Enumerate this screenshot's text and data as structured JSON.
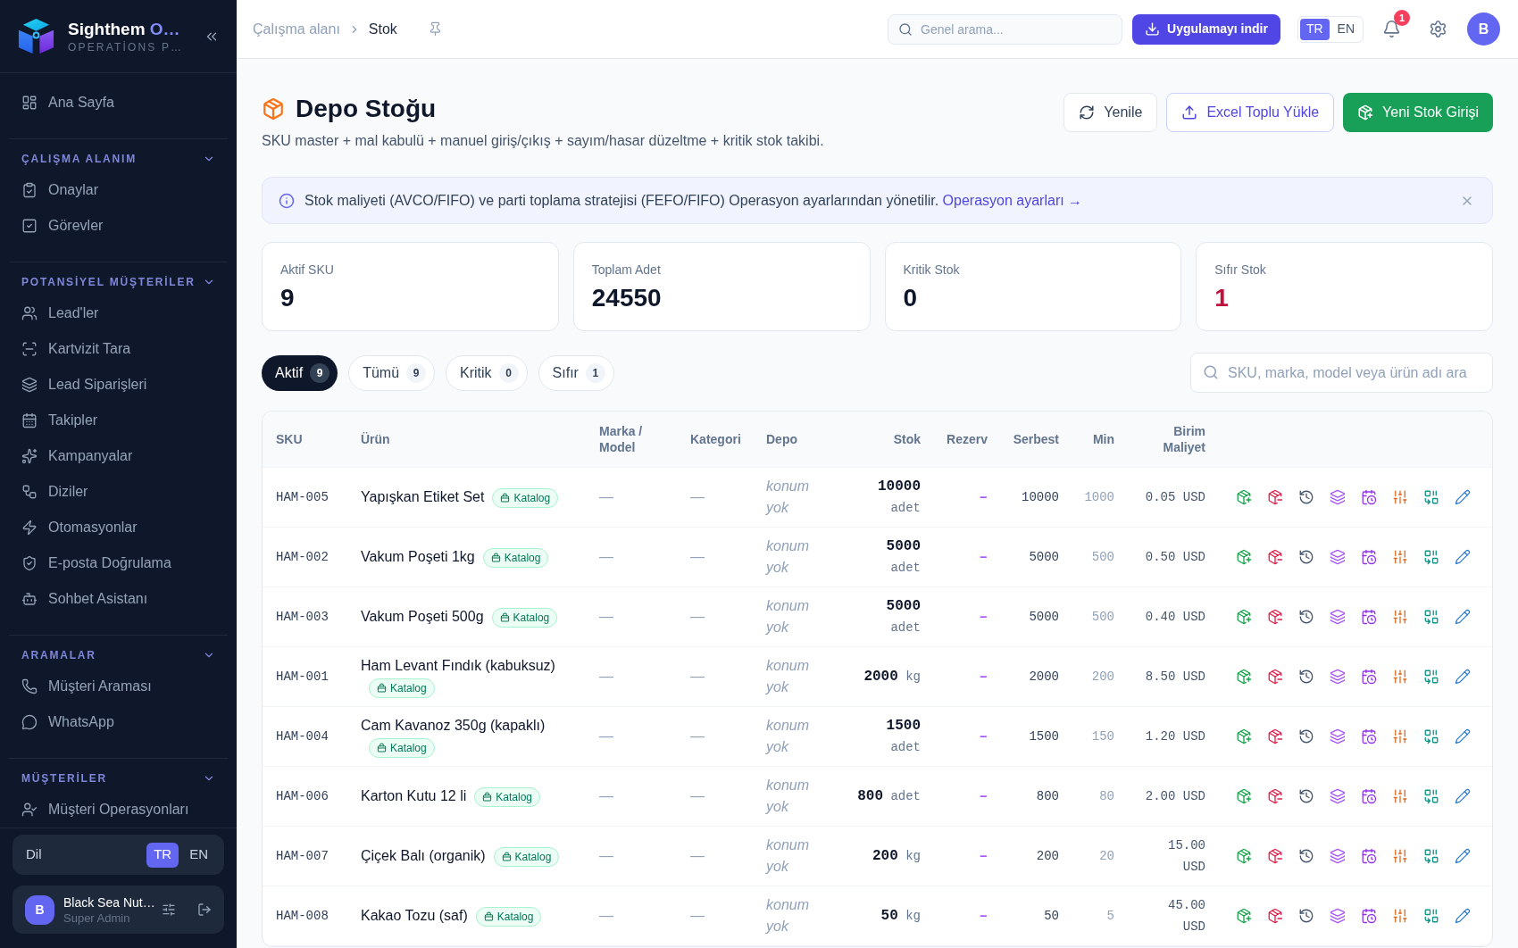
{
  "sidebar": {
    "brand": {
      "name": "Sighthem",
      "name_accent": "O…",
      "tagline": "OPERATİONS P…"
    },
    "nav": [
      {
        "kind": "link",
        "label": "Ana Sayfa",
        "selected": false
      },
      {
        "kind": "section",
        "title": "ÇALIŞMA ALANIM",
        "expanded": true,
        "items": [
          {
            "label": "Onaylar",
            "selected": false
          },
          {
            "label": "Görevler",
            "selected": false
          }
        ]
      },
      {
        "kind": "section",
        "title": "POTANSİYEL MÜŞTERİLER",
        "expanded": true,
        "items": [
          {
            "label": "Lead'ler",
            "selected": false
          },
          {
            "label": "Kartvizit Tara",
            "selected": false
          },
          {
            "label": "Lead Siparişleri",
            "selected": false
          },
          {
            "label": "Takipler",
            "selected": false
          },
          {
            "label": "Kampanyalar",
            "selected": false
          },
          {
            "label": "Diziler",
            "selected": false
          },
          {
            "label": "Otomasyonlar",
            "selected": false
          },
          {
            "label": "E-posta Doğrulama",
            "selected": false
          },
          {
            "label": "Sohbet Asistanı",
            "selected": false
          }
        ]
      },
      {
        "kind": "section",
        "title": "ARAMALAR",
        "expanded": true,
        "items": [
          {
            "label": "Müşteri Araması",
            "selected": false
          },
          {
            "label": "WhatsApp",
            "selected": false
          }
        ]
      },
      {
        "kind": "section",
        "title": "MÜŞTERİLER",
        "expanded": true,
        "items": [
          {
            "label": "Müşteri Operasyonları",
            "selected": false
          }
        ]
      }
    ],
    "language": {
      "label": "Dil",
      "options": [
        {
          "label": "TR",
          "selected": true
        },
        {
          "label": "EN",
          "selected": false
        }
      ]
    },
    "user": {
      "avatar": "B",
      "name": "Black Sea Nut…",
      "role": "Super Admin"
    }
  },
  "topbar": {
    "breadcrumb": [
      "Çalışma alanı",
      "Stok"
    ],
    "search": {
      "placeholder": "Genel arama..."
    },
    "download_button": "Uygulamayı indir",
    "language": {
      "options": [
        {
          "label": "TR",
          "selected": true
        },
        {
          "label": "EN",
          "selected": false
        }
      ]
    },
    "notifications": {
      "count": "1"
    },
    "avatar": "B"
  },
  "page": {
    "title": "Depo Stoğu",
    "subtitle": "SKU master + mal kabulü + manuel giriş/çıkış + sayım/hasar düzeltme + kritik stok takibi.",
    "actions": [
      {
        "kind": "outline",
        "label": "Yenile"
      },
      {
        "kind": "accent",
        "label": "Excel Toplu Yükle"
      },
      {
        "kind": "primary",
        "label": "Yeni Stok Girişi"
      }
    ]
  },
  "notice": {
    "text": "Stok maliyeti (AVCO/FIFO) ve parti toplama stratejisi (FEFO/FIFO) Operasyon ayarlarından yönetilir.",
    "link": "Operasyon ayarları →"
  },
  "stats": [
    {
      "label": "Aktif SKU",
      "value": "9",
      "color": "#0f172a"
    },
    {
      "label": "Toplam Adet",
      "value": "24550",
      "color": "#0f172a"
    },
    {
      "label": "Kritik Stok",
      "value": "0",
      "color": "#0f172a"
    },
    {
      "label": "Sıfır Stok",
      "value": "1",
      "color": "#be123c"
    }
  ],
  "filters": {
    "tabs": [
      {
        "label": "Aktif",
        "count": "9",
        "selected": true
      },
      {
        "label": "Tümü",
        "count": "9",
        "selected": false
      },
      {
        "label": "Kritik",
        "count": "0",
        "selected": false
      },
      {
        "label": "Sıfır",
        "count": "1",
        "selected": false
      }
    ],
    "search": {
      "placeholder": "SKU, marka, model veya ürün adı ara"
    }
  },
  "table": {
    "columns": [
      "SKU",
      "Ürün",
      "Marka / Model",
      "Kategori",
      "Depo",
      "Stok",
      "Rezerv",
      "Serbest",
      "Min",
      "Birim Maliyet"
    ],
    "rows": [
      {
        "sku": "HAM-005",
        "product": "Yapışkan Etiket Set",
        "tag": "Katalog",
        "brand_model": "—",
        "category": "—",
        "location": "konum yok",
        "stock": "10000",
        "unit": "adet",
        "reserved": "–",
        "free": "10000",
        "min": "1000",
        "unit_cost": "0.05 USD"
      },
      {
        "sku": "HAM-002",
        "product": "Vakum Poşeti 1kg",
        "tag": "Katalog",
        "brand_model": "—",
        "category": "—",
        "location": "konum yok",
        "stock": "5000",
        "unit": "adet",
        "reserved": "–",
        "free": "5000",
        "min": "500",
        "unit_cost": "0.50 USD"
      },
      {
        "sku": "HAM-003",
        "product": "Vakum Poşeti 500g",
        "tag": "Katalog",
        "brand_model": "—",
        "category": "—",
        "location": "konum yok",
        "stock": "5000",
        "unit": "adet",
        "reserved": "–",
        "free": "5000",
        "min": "500",
        "unit_cost": "0.40 USD"
      },
      {
        "sku": "HAM-001",
        "product": "Ham Levant Fındık (kabuksuz)",
        "tag": "Katalog",
        "brand_model": "—",
        "category": "—",
        "location": "konum yok",
        "stock": "2000",
        "unit": "kg",
        "reserved": "–",
        "free": "2000",
        "min": "200",
        "unit_cost": "8.50 USD"
      },
      {
        "sku": "HAM-004",
        "product": "Cam Kavanoz 350g (kapaklı)",
        "tag": "Katalog",
        "brand_model": "—",
        "category": "—",
        "location": "konum yok",
        "stock": "1500",
        "unit": "adet",
        "reserved": "–",
        "free": "1500",
        "min": "150",
        "unit_cost": "1.20 USD"
      },
      {
        "sku": "HAM-006",
        "product": "Karton Kutu 12 li",
        "tag": "Katalog",
        "brand_model": "—",
        "category": "—",
        "location": "konum yok",
        "stock": "800",
        "unit": "adet",
        "reserved": "–",
        "free": "800",
        "min": "80",
        "unit_cost": "2.00 USD"
      },
      {
        "sku": "HAM-007",
        "product": "Çiçek Balı (organik)",
        "tag": "Katalog",
        "brand_model": "—",
        "category": "—",
        "location": "konum yok",
        "stock": "200",
        "unit": "kg",
        "reserved": "–",
        "free": "200",
        "min": "20",
        "unit_cost": "15.00 USD"
      },
      {
        "sku": "HAM-008",
        "product": "Kakao Tozu (saf)",
        "tag": "Katalog",
        "brand_model": "—",
        "category": "—",
        "location": "konum yok",
        "stock": "50",
        "unit": "kg",
        "reserved": "–",
        "free": "50",
        "min": "5",
        "unit_cost": "45.00 USD"
      }
    ]
  }
}
